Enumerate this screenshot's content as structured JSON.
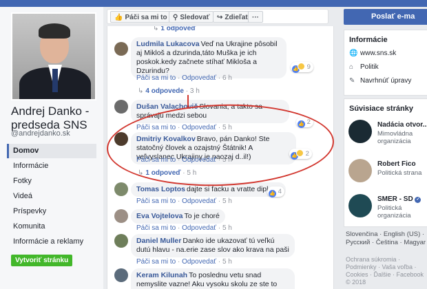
{
  "left": {
    "page_name": "Andrej Danko - predseda SNS",
    "handle": "@andrejdanko.sk",
    "nav": [
      "Domov",
      "Informácie",
      "Fotky",
      "Videá",
      "Príspevky",
      "Komunita",
      "Informácie a reklamy"
    ],
    "create_btn": "Vytvoriť stránku"
  },
  "actionbar": {
    "like": "Páči sa mi to",
    "follow": "Sledovať",
    "share": "Zdieľať",
    "more": "···"
  },
  "comments": [
    {
      "author": "",
      "text": "",
      "top_reply": "1 odpoveď"
    },
    {
      "author": "Ludmila Lukacova",
      "text": "Veď na Ukrajine pôsobil aj Mikloš a dzurinda,táto Muška je ich poskok.kedy začnete stíhať Mikloša a Dzurindu?",
      "like": "Páči sa mi to",
      "reply": "Odpovedať",
      "time": "6 h",
      "reactions": "9",
      "replies": "4 odpovede",
      "replies_time": "3 h"
    },
    {
      "author": "Dušan Valachovič",
      "text": "Slovania, a takto sa správajú medzi sebou",
      "like": "Páči sa mi to",
      "reply": "Odpovedať",
      "time": "5 h",
      "reactions": "2"
    },
    {
      "author": "Dmitriy Kovalkov",
      "text": "Bravo, pán Danko! Ste statočný človek a ozajstný Štátnik! A veľvyslanec Ukrajiny je naozaj d..il!)",
      "like": "Páči sa mi to",
      "reply": "Odpovedať",
      "time": "5 h",
      "reactions": "2",
      "replies": "1 odpoveď",
      "replies_time": "5 h"
    },
    {
      "author": "Tomas Loptos",
      "text": "dajte si facku a vratte diplom.",
      "like": "Páči sa mi to",
      "reply": "Odpovedať",
      "time": "5 h",
      "reactions": "4"
    },
    {
      "author": "Eva Vojtelova",
      "text": "To je choré",
      "like": "Páči sa mi to",
      "reply": "Odpovedať",
      "time": "5 h"
    },
    {
      "author": "Daniel Muller",
      "text": "Danko ide ukazovať tú veľkú dutú hlavu - na.erie zase slov ako krava na paši",
      "like": "Páči sa mi to",
      "reply": "Odpovedať",
      "time": "5 h"
    },
    {
      "author": "Keram Kilunah",
      "text": "To poslednu vetu snad nemyslite vazne! Aku vysoku skolu ze ste to vystudoval?"
    }
  ],
  "right": {
    "send_btn": "Poslať e-ma",
    "info_title": "Informácie",
    "info": [
      "www.sns.sk",
      "Politik",
      "Navrhnúť úpravy"
    ],
    "related_title": "Súvisiace stránky",
    "related": [
      {
        "name": "Nadácia otvor...",
        "cat": "Mimovládna organizácia"
      },
      {
        "name": "Robert Fico",
        "cat": "Politická strana"
      },
      {
        "name": "SMER - SD",
        "cat": "Politická organizácia"
      }
    ],
    "languages": "Slovenčina · English (US) · Русский · Čeština · Magyar",
    "footer": "Ochrana súkromia · Podmienky · Vaša voľba · Cookies · Ďalšie · Facebook © 2018"
  },
  "colors": {
    "brand": "#4267b2",
    "link": "#385898",
    "highlight": "#d2372f",
    "create": "#42b72a"
  }
}
